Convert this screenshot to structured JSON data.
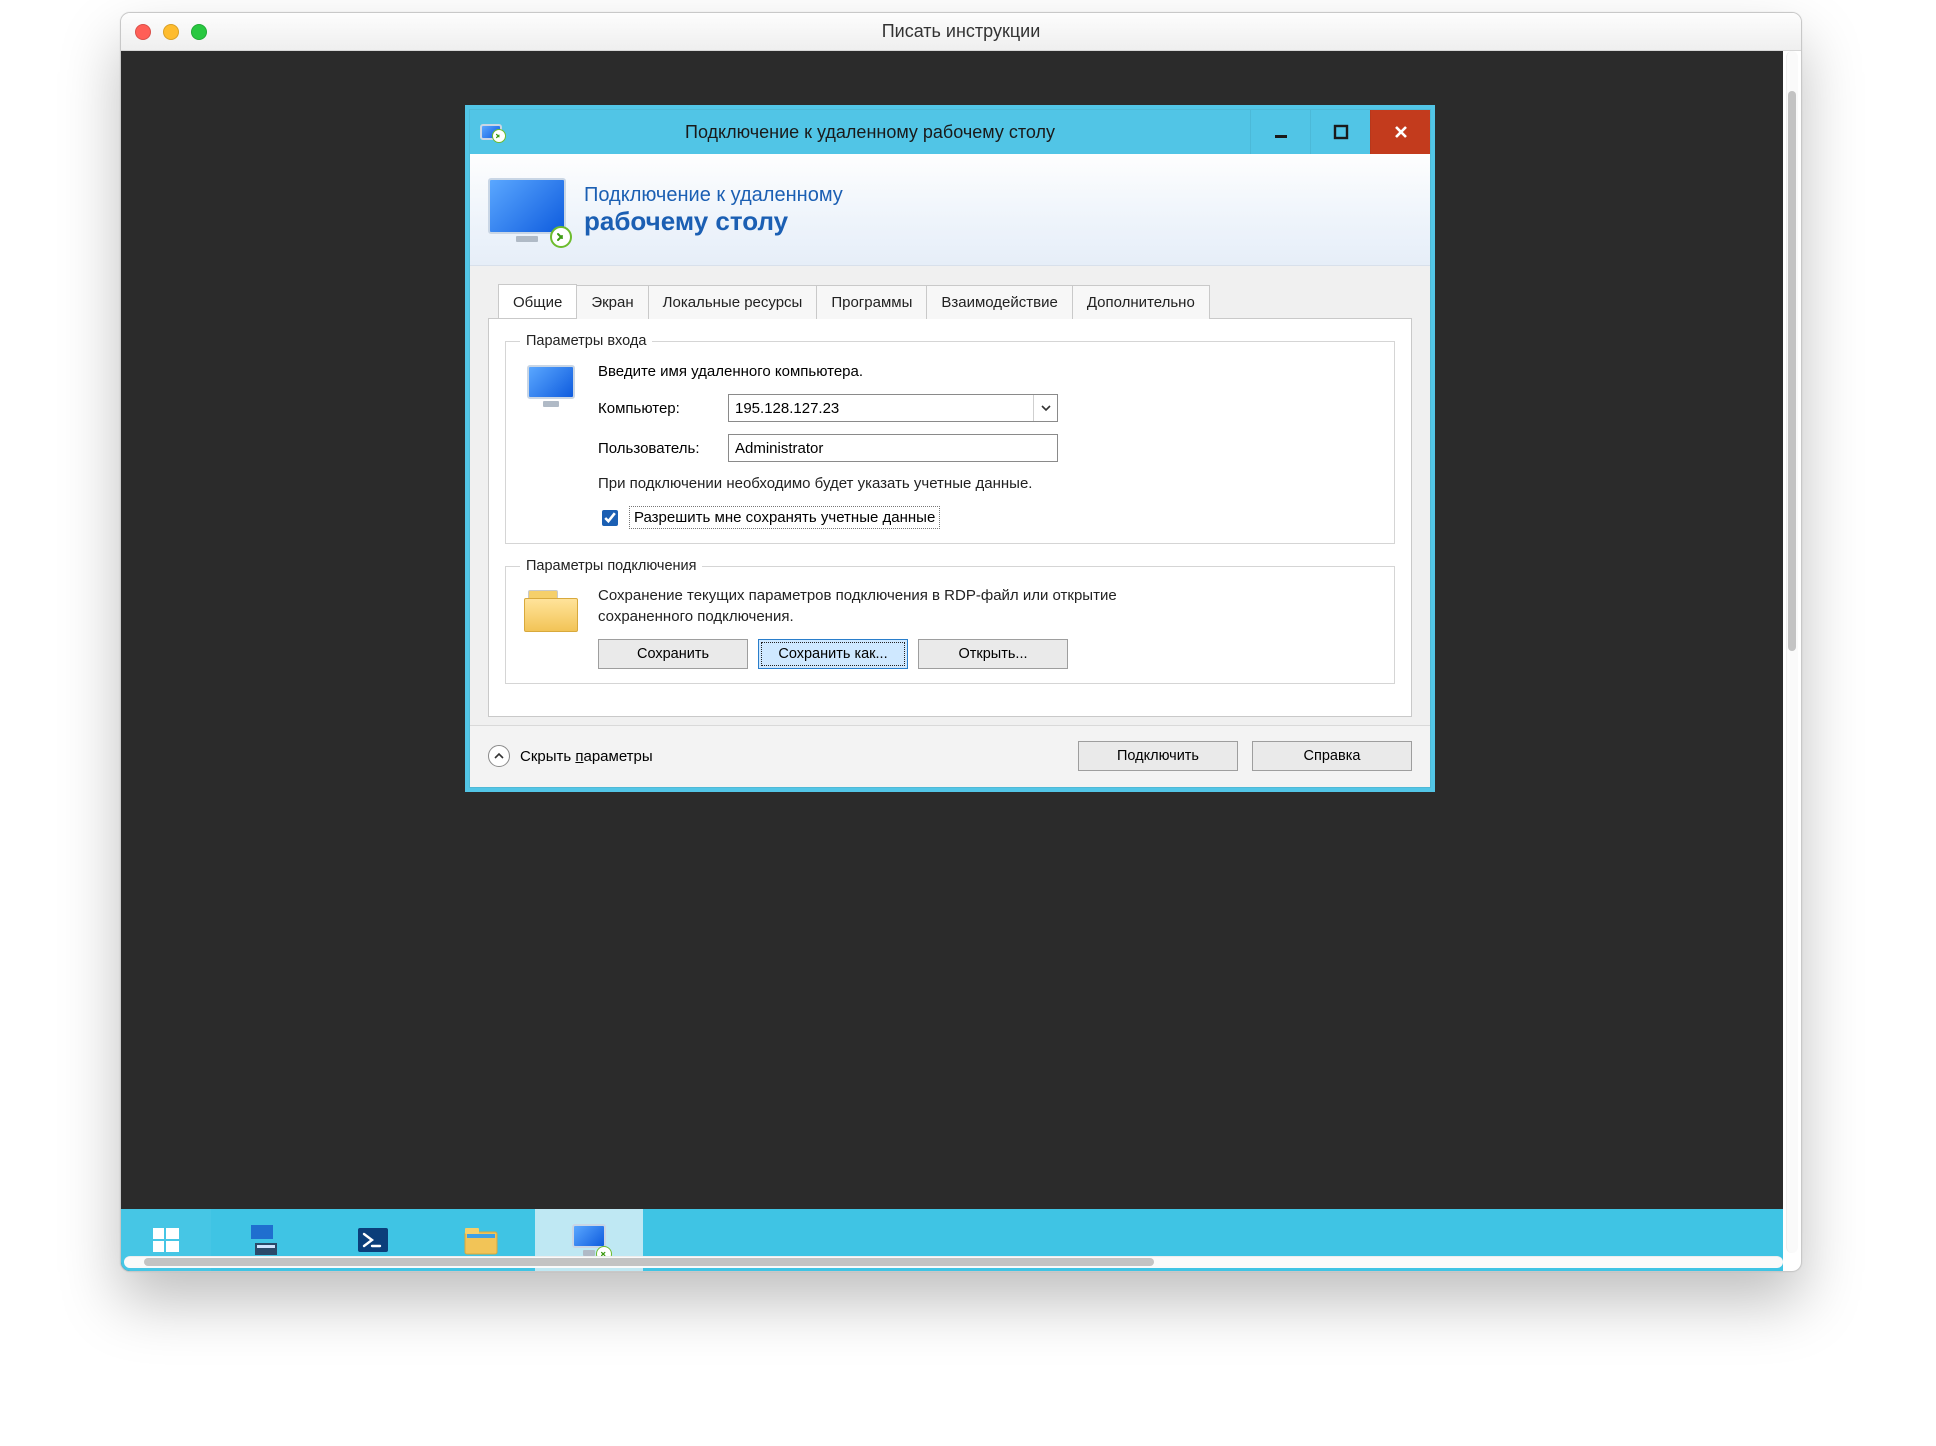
{
  "mac": {
    "title": "Писать инструкции"
  },
  "rdp": {
    "window_title": "Подключение к удаленному рабочему столу",
    "banner": {
      "line1": "Подключение к удаленному",
      "line2": "рабочему столу"
    },
    "tabs": {
      "general": "Общие",
      "display": "Экран",
      "local": "Локальные ресурсы",
      "programs": "Программы",
      "experience": "Взаимодействие",
      "advanced": "Дополнительно"
    },
    "login_group": {
      "legend": "Параметры входа",
      "instruction": "Введите имя удаленного компьютера.",
      "computer_label": "Компьютер:",
      "computer_value": "195.128.127.23",
      "user_label": "Пользователь:",
      "user_value": "Administrator",
      "note": "При подключении необходимо будет указать учетные данные.",
      "allow_save_label": "Разрешить мне сохранять учетные данные",
      "allow_save_checked": true
    },
    "conn_group": {
      "legend": "Параметры подключения",
      "note": "Сохранение текущих параметров подключения в RDP-файл или открытие сохраненного подключения.",
      "save": "Сохранить",
      "save_as": "Сохранить как...",
      "open": "Открыть..."
    },
    "footer": {
      "toggle_prefix": "Скрыть ",
      "toggle_letter": "п",
      "toggle_suffix": "араметры",
      "connect": "Подключить",
      "help": "Справка"
    }
  }
}
